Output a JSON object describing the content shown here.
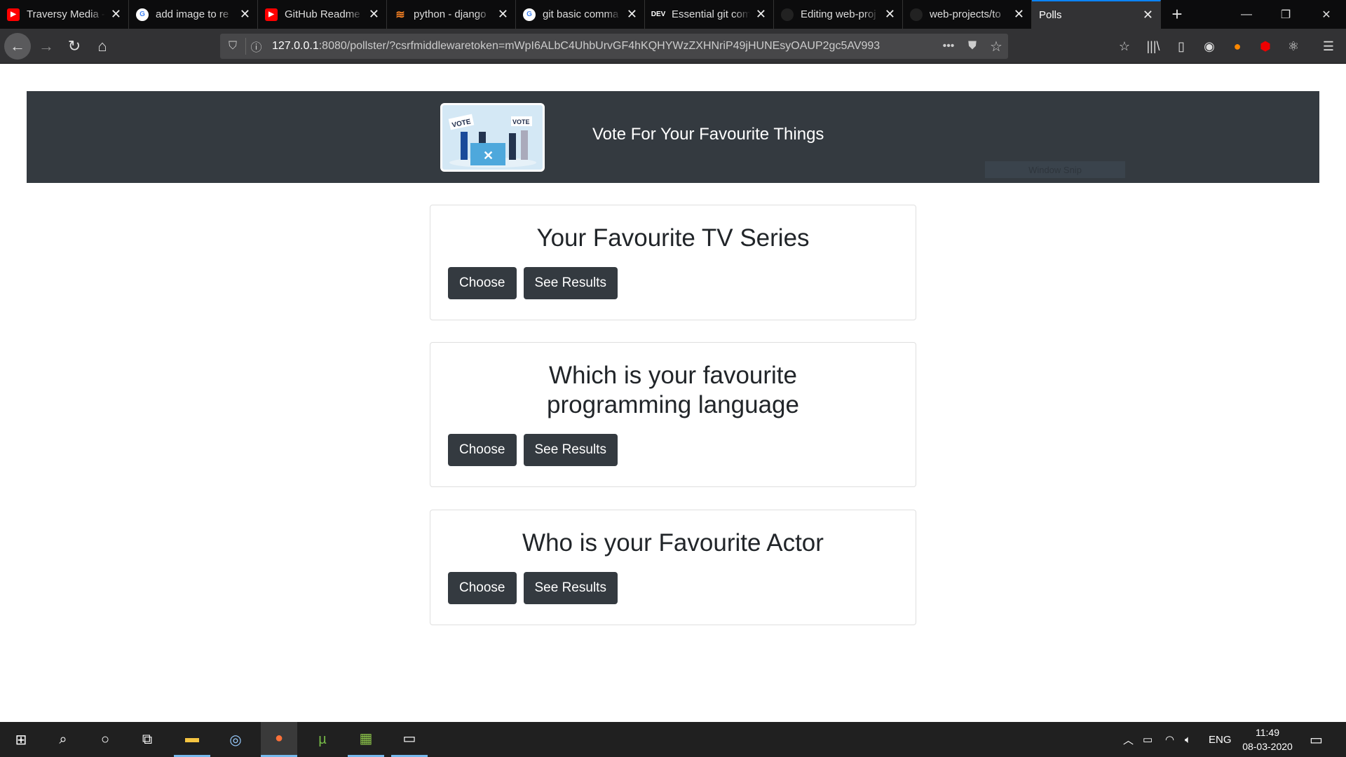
{
  "browser": {
    "tabs": [
      {
        "title": "Traversy Media - ",
        "icon": "youtube-icon"
      },
      {
        "title": "add image to re",
        "icon": "google-icon"
      },
      {
        "title": "GitHub Readme",
        "icon": "youtube-icon"
      },
      {
        "title": "python - django",
        "icon": "stackoverflow-icon"
      },
      {
        "title": "git basic comma",
        "icon": "google-icon"
      },
      {
        "title": "Essential git com",
        "icon": "dev-icon",
        "icon_text": "DEV"
      },
      {
        "title": "Editing web-proj",
        "icon": "github-icon"
      },
      {
        "title": "web-projects/to",
        "icon": "github-icon"
      },
      {
        "title": "Polls",
        "icon": "none",
        "active": true
      }
    ],
    "url_host": "127.0.0.1",
    "url_rest": ":8080/pollster/?csrfmiddlewaretoken=mWpI6ALbC4UhbUrvGF4hKQHYWzZXHNriP49jHUNEsyOAUP2gc5AV993"
  },
  "header": {
    "title": "Vote For Your Favourite Things",
    "logo_text": "VOTE",
    "snip": "Window Snip"
  },
  "polls": [
    {
      "question": "Your Favourite TV Series",
      "choose": "Choose",
      "results": "See Results"
    },
    {
      "question": "Which is your favourite programming language",
      "choose": "Choose",
      "results": "See Results"
    },
    {
      "question": "Who is your Favourite Actor",
      "choose": "Choose",
      "results": "See Results"
    }
  ],
  "taskbar": {
    "lang": "ENG",
    "time": "11:49",
    "date": "08-03-2020"
  },
  "colors": {
    "header": "#343a40",
    "button": "#343a40",
    "accent": "#0a84ff"
  }
}
